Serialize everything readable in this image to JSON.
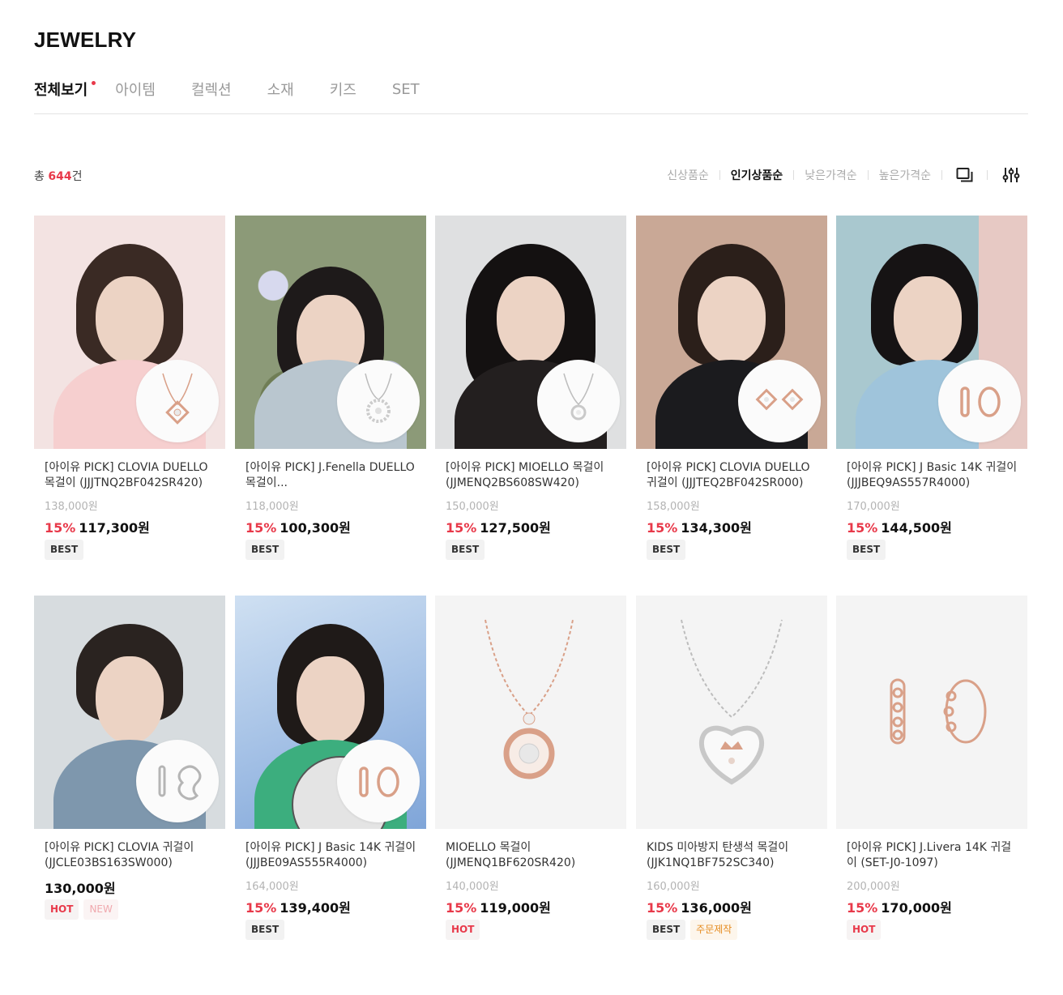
{
  "page_title": "JEWELRY",
  "tabs": [
    {
      "label": "전체보기",
      "active": true
    },
    {
      "label": "아이템"
    },
    {
      "label": "컬렉션"
    },
    {
      "label": "소재"
    },
    {
      "label": "키즈"
    },
    {
      "label": "SET"
    }
  ],
  "summary": {
    "prefix": "총 ",
    "count": "644",
    "suffix": "건"
  },
  "sort_options": [
    {
      "label": "신상품순"
    },
    {
      "label": "인기상품순",
      "active": true
    },
    {
      "label": "낮은가격순"
    },
    {
      "label": "높은가격순"
    }
  ],
  "toolbar": {
    "view_icon": "grid-view-icon",
    "filter_icon": "filter-sliders-icon"
  },
  "colors": {
    "accent": "#e8394a",
    "muted": "#9a9a9a",
    "rose_gold": "#d9a088",
    "silver": "#b8b8b8"
  },
  "products": [
    {
      "name": "[아이유 PICK] CLOVIA DUELLO 목걸이 (JJJTNQ2BF042SR420)",
      "original_price": "138,000원",
      "discount": "15%",
      "price": "117,300원",
      "tags": [
        "BEST"
      ]
    },
    {
      "name": "[아이유 PICK] J.Fenella DUELLO 목걸이...",
      "original_price": "118,000원",
      "discount": "15%",
      "price": "100,300원",
      "tags": [
        "BEST"
      ]
    },
    {
      "name": "[아이유 PICK] MIOELLO 목걸이 (JJMENQ2BS608SW420)",
      "original_price": "150,000원",
      "discount": "15%",
      "price": "127,500원",
      "tags": [
        "BEST"
      ]
    },
    {
      "name": "[아이유 PICK] CLOVIA DUELLO 귀걸이 (JJJTEQ2BF042SR000)",
      "original_price": "158,000원",
      "discount": "15%",
      "price": "134,300원",
      "tags": [
        "BEST"
      ]
    },
    {
      "name": "[아이유 PICK] J Basic 14K 귀걸이 (JJJBEQ9AS557R4000)",
      "original_price": "170,000원",
      "discount": "15%",
      "price": "144,500원",
      "tags": [
        "BEST"
      ]
    },
    {
      "name": "[아이유 PICK] CLOVIA 귀걸이 (JJCLE03BS163SW000)",
      "original_price": "",
      "discount": "",
      "price": "130,000원",
      "tags": [
        "HOT",
        "NEW"
      ]
    },
    {
      "name": "[아이유 PICK] J Basic 14K 귀걸이 (JJJBE09AS555R4000)",
      "original_price": "164,000원",
      "discount": "15%",
      "price": "139,400원",
      "tags": [
        "BEST"
      ]
    },
    {
      "name": "MIOELLO 목걸이 (JJMENQ1BF620SR420)",
      "original_price": "140,000원",
      "discount": "15%",
      "price": "119,000원",
      "tags": [
        "HOT"
      ]
    },
    {
      "name": "KIDS 미아방지 탄생석 목걸이 (JJK1NQ1BF752SC340)",
      "original_price": "160,000원",
      "discount": "15%",
      "price": "136,000원",
      "tags": [
        "BEST",
        "주문제작"
      ]
    },
    {
      "name": "[아이유 PICK] J.Livera 14K 귀걸이 (SET-J0-1097)",
      "original_price": "200,000원",
      "discount": "15%",
      "price": "170,000원",
      "tags": [
        "HOT"
      ]
    }
  ]
}
